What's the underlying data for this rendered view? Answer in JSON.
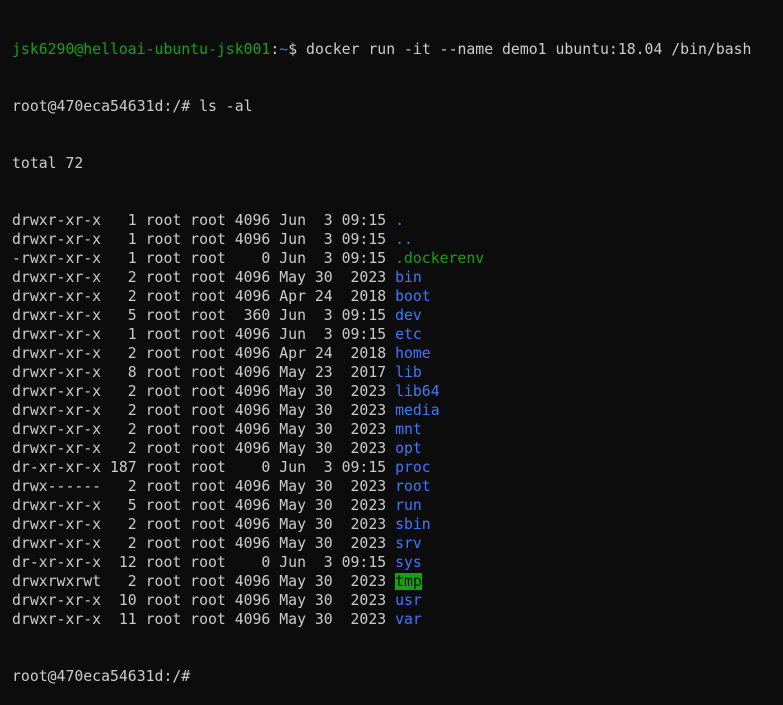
{
  "prompt1": {
    "user_host": "jsk6290@helloai-ubuntu-jsk001",
    "sep": ":",
    "path": "~",
    "dollar": "$ ",
    "command": "docker run -it --name demo1 ubuntu:18.04 /bin/bash"
  },
  "prompt2": {
    "text": "root@470eca54631d:/# ",
    "command": "ls -al"
  },
  "total": "total 72",
  "entries": [
    {
      "perm": "drwxr-xr-x",
      "links": "1",
      "owner": "root",
      "group": "root",
      "size": "4096",
      "month": "Jun",
      "day": "3",
      "time": "09:15",
      "name": ".",
      "style": "dir"
    },
    {
      "perm": "drwxr-xr-x",
      "links": "1",
      "owner": "root",
      "group": "root",
      "size": "4096",
      "month": "Jun",
      "day": "3",
      "time": "09:15",
      "name": "..",
      "style": "dir"
    },
    {
      "perm": "-rwxr-xr-x",
      "links": "1",
      "owner": "root",
      "group": "root",
      "size": "0",
      "month": "Jun",
      "day": "3",
      "time": "09:15",
      "name": ".dockerenv",
      "style": "file-green"
    },
    {
      "perm": "drwxr-xr-x",
      "links": "2",
      "owner": "root",
      "group": "root",
      "size": "4096",
      "month": "May",
      "day": "30",
      "time": "2023",
      "name": "bin",
      "style": "dir"
    },
    {
      "perm": "drwxr-xr-x",
      "links": "2",
      "owner": "root",
      "group": "root",
      "size": "4096",
      "month": "Apr",
      "day": "24",
      "time": "2018",
      "name": "boot",
      "style": "dir"
    },
    {
      "perm": "drwxr-xr-x",
      "links": "5",
      "owner": "root",
      "group": "root",
      "size": "360",
      "month": "Jun",
      "day": "3",
      "time": "09:15",
      "name": "dev",
      "style": "dir"
    },
    {
      "perm": "drwxr-xr-x",
      "links": "1",
      "owner": "root",
      "group": "root",
      "size": "4096",
      "month": "Jun",
      "day": "3",
      "time": "09:15",
      "name": "etc",
      "style": "dir"
    },
    {
      "perm": "drwxr-xr-x",
      "links": "2",
      "owner": "root",
      "group": "root",
      "size": "4096",
      "month": "Apr",
      "day": "24",
      "time": "2018",
      "name": "home",
      "style": "dir"
    },
    {
      "perm": "drwxr-xr-x",
      "links": "8",
      "owner": "root",
      "group": "root",
      "size": "4096",
      "month": "May",
      "day": "23",
      "time": "2017",
      "name": "lib",
      "style": "dir"
    },
    {
      "perm": "drwxr-xr-x",
      "links": "2",
      "owner": "root",
      "group": "root",
      "size": "4096",
      "month": "May",
      "day": "30",
      "time": "2023",
      "name": "lib64",
      "style": "dir"
    },
    {
      "perm": "drwxr-xr-x",
      "links": "2",
      "owner": "root",
      "group": "root",
      "size": "4096",
      "month": "May",
      "day": "30",
      "time": "2023",
      "name": "media",
      "style": "dir"
    },
    {
      "perm": "drwxr-xr-x",
      "links": "2",
      "owner": "root",
      "group": "root",
      "size": "4096",
      "month": "May",
      "day": "30",
      "time": "2023",
      "name": "mnt",
      "style": "dir"
    },
    {
      "perm": "drwxr-xr-x",
      "links": "2",
      "owner": "root",
      "group": "root",
      "size": "4096",
      "month": "May",
      "day": "30",
      "time": "2023",
      "name": "opt",
      "style": "dir"
    },
    {
      "perm": "dr-xr-xr-x",
      "links": "187",
      "owner": "root",
      "group": "root",
      "size": "0",
      "month": "Jun",
      "day": "3",
      "time": "09:15",
      "name": "proc",
      "style": "dir"
    },
    {
      "perm": "drwx------",
      "links": "2",
      "owner": "root",
      "group": "root",
      "size": "4096",
      "month": "May",
      "day": "30",
      "time": "2023",
      "name": "root",
      "style": "dir"
    },
    {
      "perm": "drwxr-xr-x",
      "links": "5",
      "owner": "root",
      "group": "root",
      "size": "4096",
      "month": "May",
      "day": "30",
      "time": "2023",
      "name": "run",
      "style": "dir"
    },
    {
      "perm": "drwxr-xr-x",
      "links": "2",
      "owner": "root",
      "group": "root",
      "size": "4096",
      "month": "May",
      "day": "30",
      "time": "2023",
      "name": "sbin",
      "style": "dir"
    },
    {
      "perm": "drwxr-xr-x",
      "links": "2",
      "owner": "root",
      "group": "root",
      "size": "4096",
      "month": "May",
      "day": "30",
      "time": "2023",
      "name": "srv",
      "style": "dir"
    },
    {
      "perm": "dr-xr-xr-x",
      "links": "12",
      "owner": "root",
      "group": "root",
      "size": "0",
      "month": "Jun",
      "day": "3",
      "time": "09:15",
      "name": "sys",
      "style": "dir"
    },
    {
      "perm": "drwxrwxrwt",
      "links": "2",
      "owner": "root",
      "group": "root",
      "size": "4096",
      "month": "May",
      "day": "30",
      "time": "2023",
      "name": "tmp",
      "style": "sticky"
    },
    {
      "perm": "drwxr-xr-x",
      "links": "10",
      "owner": "root",
      "group": "root",
      "size": "4096",
      "month": "May",
      "day": "30",
      "time": "2023",
      "name": "usr",
      "style": "dir"
    },
    {
      "perm": "drwxr-xr-x",
      "links": "11",
      "owner": "root",
      "group": "root",
      "size": "4096",
      "month": "May",
      "day": "30",
      "time": "2023",
      "name": "var",
      "style": "dir"
    }
  ],
  "prompt3": {
    "text": "root@470eca54631d:/# "
  },
  "colors": {
    "background": "#0c0c0c",
    "foreground": "#cccccc",
    "green": "#13a10e",
    "blue": "#3b78ff"
  }
}
